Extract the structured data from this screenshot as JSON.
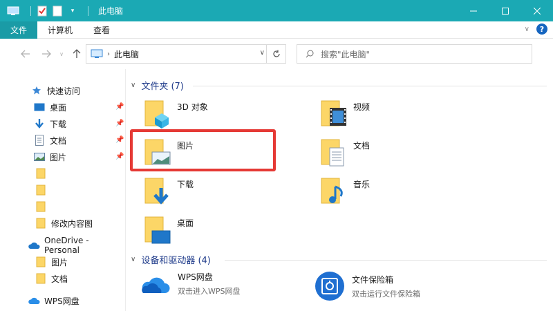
{
  "window": {
    "title": "此电脑",
    "accent": "#1ba9b4"
  },
  "ribbon": {
    "tabs": [
      {
        "label": "文件",
        "active": true
      },
      {
        "label": "计算机",
        "active": false
      },
      {
        "label": "查看",
        "active": false
      }
    ],
    "help_label": "?"
  },
  "address": {
    "crumb": "此电脑",
    "search_placeholder": "搜索\"此电脑\""
  },
  "sidebar": {
    "quick_access": "快速访问",
    "items": [
      {
        "label": "桌面",
        "pinned": true
      },
      {
        "label": "下载",
        "pinned": true
      },
      {
        "label": "文档",
        "pinned": true
      },
      {
        "label": "图片",
        "pinned": true
      },
      {
        "label": ""
      },
      {
        "label": ""
      },
      {
        "label": ""
      },
      {
        "label": "修改内容图"
      }
    ],
    "onedrive": "OneDrive - Personal",
    "onedrive_items": [
      {
        "label": "图片"
      },
      {
        "label": "文档"
      }
    ],
    "wps": "WPS网盘"
  },
  "folders": {
    "header": "文件夹 (7)",
    "items": [
      {
        "label": "3D 对象",
        "icon": "3d-objects-folder-icon"
      },
      {
        "label": "视频",
        "icon": "videos-folder-icon"
      },
      {
        "label": "图片",
        "icon": "pictures-folder-icon"
      },
      {
        "label": "文档",
        "icon": "documents-folder-icon"
      },
      {
        "label": "下载",
        "icon": "downloads-folder-icon"
      },
      {
        "label": "音乐",
        "icon": "music-folder-icon"
      },
      {
        "label": "桌面",
        "icon": "desktop-folder-icon"
      }
    ]
  },
  "drives": {
    "header": "设备和驱动器 (4)",
    "items": [
      {
        "name": "WPS网盘",
        "sub": "双击进入WPS网盘"
      },
      {
        "name": "文件保险箱",
        "sub": "双击运行文件保险箱"
      }
    ]
  }
}
